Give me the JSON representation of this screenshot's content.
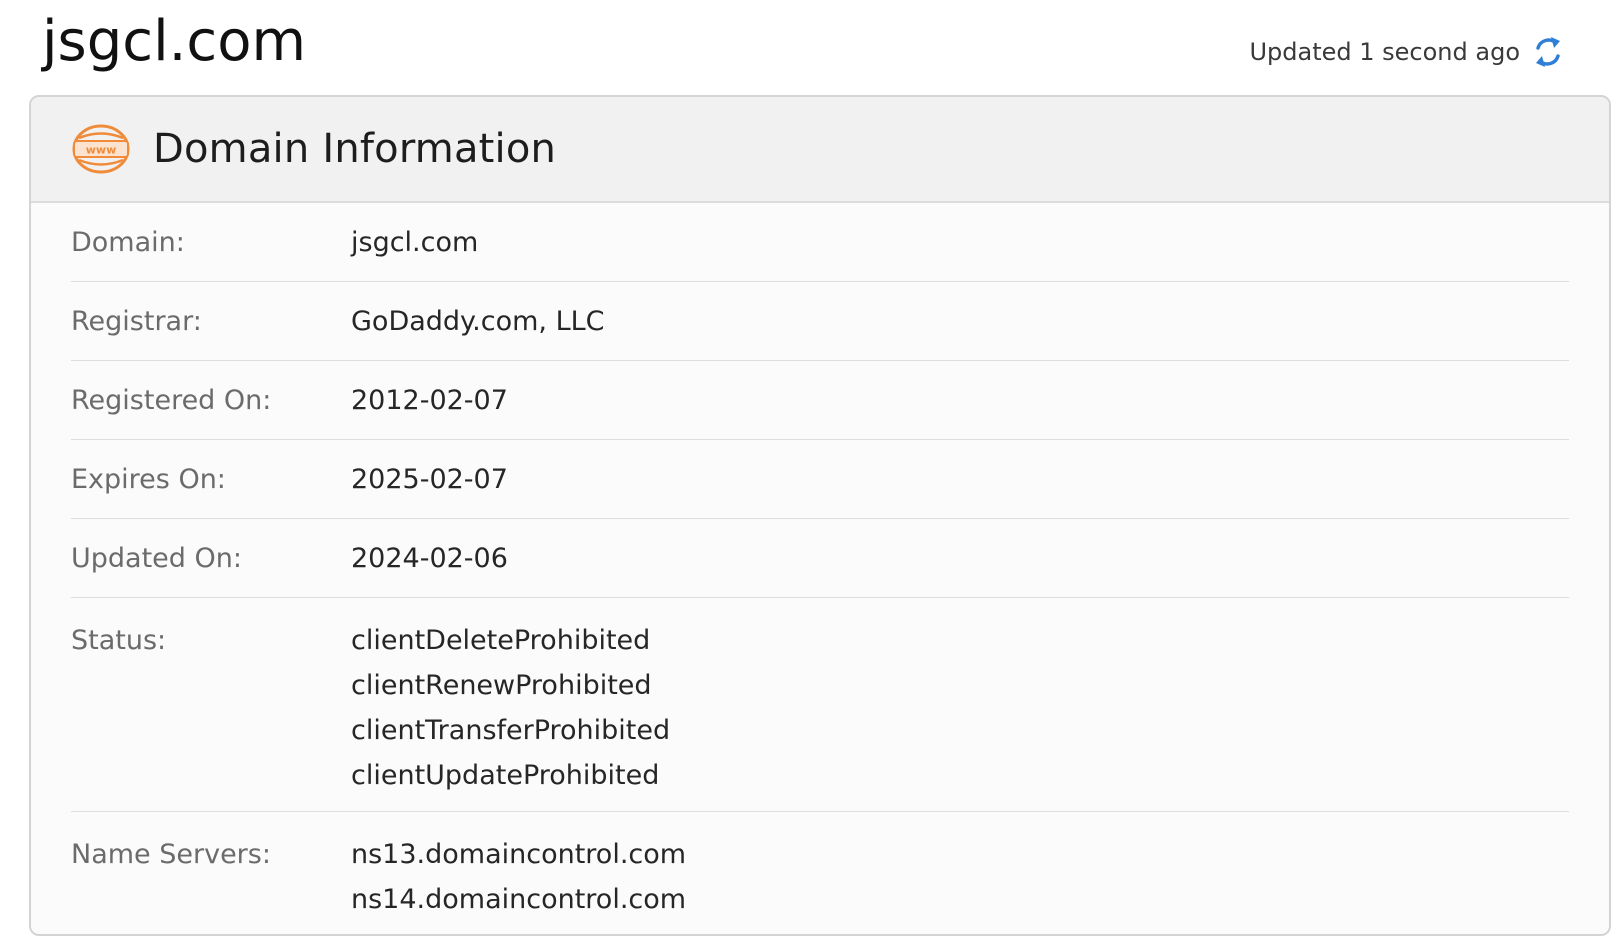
{
  "page": {
    "title": "jsgcl.com",
    "updated_text": "Updated 1 second ago",
    "refresh_icon": "refresh-icon"
  },
  "card": {
    "icon": "www-globe-icon",
    "title": "Domain Information"
  },
  "rows": {
    "domain": {
      "label": "Domain:",
      "value": "jsgcl.com"
    },
    "registrar": {
      "label": "Registrar:",
      "value": "GoDaddy.com, LLC"
    },
    "registered_on": {
      "label": "Registered On:",
      "value": "2012-02-07"
    },
    "expires_on": {
      "label": "Expires On:",
      "value": "2025-02-07"
    },
    "updated_on": {
      "label": "Updated On:",
      "value": "2024-02-06"
    },
    "status": {
      "label": "Status:",
      "values": [
        "clientDeleteProhibited",
        "clientRenewProhibited",
        "clientTransferProhibited",
        "clientUpdateProhibited"
      ]
    },
    "name_servers": {
      "label": "Name Servers:",
      "values": [
        "ns13.domaincontrol.com",
        "ns14.domaincontrol.com"
      ]
    }
  },
  "colors": {
    "icon_orange": "#f08b3a",
    "refresh_blue": "#2f7fd6",
    "header_bg": "#f1f1f1",
    "card_bg": "#fbfbfb"
  }
}
